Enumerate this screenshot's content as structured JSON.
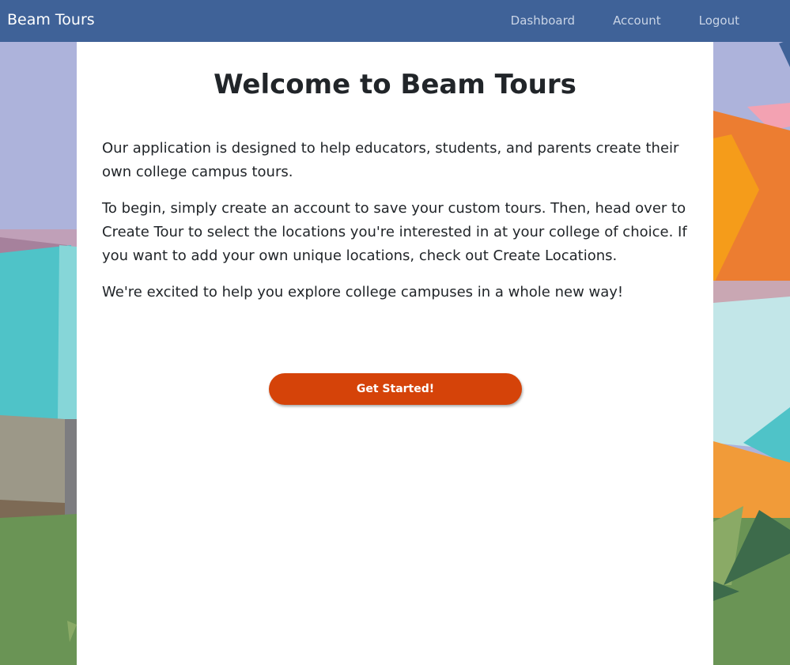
{
  "navbar": {
    "brand": "Beam Tours",
    "links": [
      {
        "label": "Dashboard"
      },
      {
        "label": "Account"
      },
      {
        "label": "Logout"
      }
    ]
  },
  "main": {
    "title": "Welcome to Beam Tours",
    "paragraphs": [
      "Our application is designed to help educators, students, and parents create their own college campus tours.",
      "To begin, simply create an account to save your custom tours. Then, head over to Create Tour to select the locations you're interested in at your college of choice. If you want to add your own unique locations, check out Create Locations.",
      "We're excited to help you explore college campuses in a whole new way!"
    ],
    "cta_label": "Get Started!"
  },
  "colors": {
    "navbar": "#3f6298",
    "cta": "#d54309",
    "panel": "#ffffff"
  }
}
